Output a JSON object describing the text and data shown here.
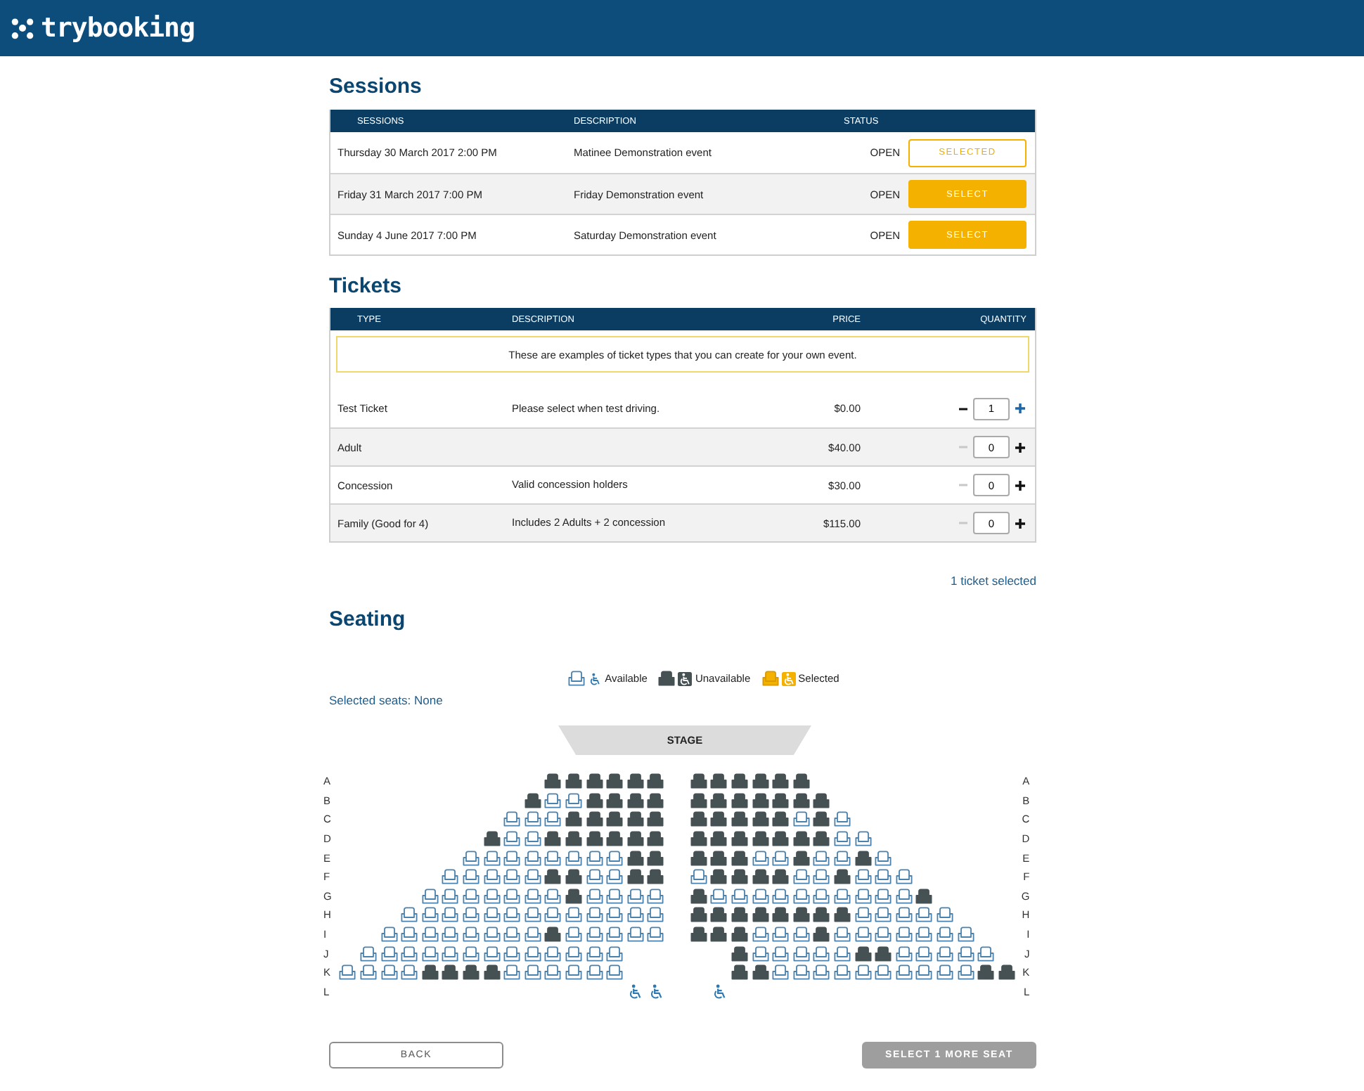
{
  "header": {
    "logo_text": "trybooking"
  },
  "sessions": {
    "title": "Sessions",
    "columns": [
      "SESSIONS",
      "DESCRIPTION",
      "STATUS"
    ],
    "rows": [
      {
        "session": "Thursday 30 March 2017 2:00 PM",
        "description": "Matinee Demonstration event",
        "status": "OPEN",
        "button": "SELECTED",
        "selected": true
      },
      {
        "session": "Friday 31 March 2017 7:00 PM",
        "description": "Friday Demonstration event",
        "status": "OPEN",
        "button": "SELECT",
        "selected": false
      },
      {
        "session": "Sunday 4 June 2017 7:00 PM",
        "description": "Saturday Demonstration event",
        "status": "OPEN",
        "button": "SELECT",
        "selected": false
      }
    ]
  },
  "tickets": {
    "title": "Tickets",
    "columns": [
      "TYPE",
      "DESCRIPTION",
      "PRICE",
      "QUANTITY"
    ],
    "note": "These are examples of ticket types that you can create for your own event.",
    "rows": [
      {
        "type": "Test Ticket",
        "description": "Please select when test driving.",
        "price": "$0.00",
        "quantity": "1",
        "decrease_disabled": false
      },
      {
        "type": "Adult",
        "price": "$40.00",
        "quantity": "0",
        "decrease_disabled": true
      },
      {
        "type": "Concession",
        "description": "Valid concession holders",
        "price": "$30.00",
        "quantity": "0",
        "decrease_disabled": true
      },
      {
        "type": "Family (Good for 4)",
        "description": "Includes 2 Adults + 2 concession",
        "price": "$115.00",
        "quantity": "0",
        "decrease_disabled": true
      }
    ],
    "summary": "1 ticket selected"
  },
  "seating": {
    "title": "Seating",
    "legend": [
      {
        "kind": "available",
        "label": "Available"
      },
      {
        "kind": "unavailable",
        "label": "Unavailable"
      },
      {
        "kind": "selected",
        "label": "Selected"
      }
    ],
    "selected_seats": "Selected seats: None",
    "stage": "STAGE",
    "rows": [
      {
        "label_left": "A",
        "label_right": "A",
        "left": [
          {
            "kind": "unavailable"
          },
          {
            "kind": "unavailable"
          },
          {
            "kind": "unavailable"
          },
          {
            "kind": "unavailable"
          },
          {
            "kind": "unavailable"
          },
          {
            "kind": "unavailable"
          }
        ],
        "right": [
          {
            "kind": "unavailable"
          },
          {
            "kind": "unavailable"
          },
          {
            "kind": "unavailable"
          },
          {
            "kind": "unavailable"
          },
          {
            "kind": "unavailable"
          },
          {
            "kind": "unavailable"
          }
        ]
      },
      {
        "label_left": "B",
        "label_right": "B",
        "left": [
          {
            "kind": "unavailable"
          },
          {
            "kind": "available"
          },
          {
            "kind": "available"
          },
          {
            "kind": "unavailable"
          },
          {
            "kind": "unavailable"
          },
          {
            "kind": "unavailable"
          },
          {
            "kind": "unavailable"
          }
        ],
        "right": [
          {
            "kind": "unavailable"
          },
          {
            "kind": "unavailable"
          },
          {
            "kind": "unavailable"
          },
          {
            "kind": "unavailable"
          },
          {
            "kind": "unavailable"
          },
          {
            "kind": "unavailable"
          },
          {
            "kind": "unavailable"
          }
        ]
      },
      {
        "label_left": "C",
        "label_right": "C",
        "left": [
          {
            "kind": "available"
          },
          {
            "kind": "available"
          },
          {
            "kind": "available"
          },
          {
            "kind": "unavailable"
          },
          {
            "kind": "unavailable"
          },
          {
            "kind": "unavailable"
          },
          {
            "kind": "unavailable"
          },
          {
            "kind": "unavailable"
          }
        ],
        "right": [
          {
            "kind": "unavailable"
          },
          {
            "kind": "unavailable"
          },
          {
            "kind": "unavailable"
          },
          {
            "kind": "unavailable"
          },
          {
            "kind": "unavailable"
          },
          {
            "kind": "available"
          },
          {
            "kind": "unavailable"
          },
          {
            "kind": "available"
          }
        ]
      },
      {
        "label_left": "D",
        "label_right": "D",
        "left": [
          {
            "kind": "unavailable"
          },
          {
            "kind": "available"
          },
          {
            "kind": "available"
          },
          {
            "kind": "unavailable"
          },
          {
            "kind": "unavailable"
          },
          {
            "kind": "unavailable"
          },
          {
            "kind": "unavailable"
          },
          {
            "kind": "unavailable"
          },
          {
            "kind": "unavailable"
          }
        ],
        "right": [
          {
            "kind": "unavailable"
          },
          {
            "kind": "unavailable"
          },
          {
            "kind": "unavailable"
          },
          {
            "kind": "unavailable"
          },
          {
            "kind": "unavailable"
          },
          {
            "kind": "unavailable"
          },
          {
            "kind": "unavailable"
          },
          {
            "kind": "available"
          },
          {
            "kind": "available"
          }
        ]
      },
      {
        "label_left": "E",
        "label_right": "E",
        "left": [
          {
            "kind": "available"
          },
          {
            "kind": "available"
          },
          {
            "kind": "available"
          },
          {
            "kind": "available"
          },
          {
            "kind": "available"
          },
          {
            "kind": "available"
          },
          {
            "kind": "available"
          },
          {
            "kind": "available"
          },
          {
            "kind": "unavailable"
          },
          {
            "kind": "unavailable"
          }
        ],
        "right": [
          {
            "kind": "unavailable"
          },
          {
            "kind": "unavailable"
          },
          {
            "kind": "unavailable"
          },
          {
            "kind": "available"
          },
          {
            "kind": "available"
          },
          {
            "kind": "unavailable"
          },
          {
            "kind": "available"
          },
          {
            "kind": "available"
          },
          {
            "kind": "unavailable"
          },
          {
            "kind": "available"
          }
        ]
      },
      {
        "label_left": "F",
        "label_right": "F",
        "left": [
          {
            "kind": "available"
          },
          {
            "kind": "available"
          },
          {
            "kind": "available"
          },
          {
            "kind": "available"
          },
          {
            "kind": "available"
          },
          {
            "kind": "unavailable"
          },
          {
            "kind": "unavailable"
          },
          {
            "kind": "available"
          },
          {
            "kind": "available"
          },
          {
            "kind": "unavailable"
          },
          {
            "kind": "unavailable"
          }
        ],
        "right": [
          {
            "kind": "available"
          },
          {
            "kind": "unavailable"
          },
          {
            "kind": "unavailable"
          },
          {
            "kind": "unavailable"
          },
          {
            "kind": "unavailable"
          },
          {
            "kind": "available"
          },
          {
            "kind": "available"
          },
          {
            "kind": "unavailable"
          },
          {
            "kind": "available"
          },
          {
            "kind": "available"
          },
          {
            "kind": "available"
          }
        ]
      },
      {
        "label_left": "G",
        "label_right": "G",
        "left": [
          {
            "kind": "available"
          },
          {
            "kind": "available"
          },
          {
            "kind": "available"
          },
          {
            "kind": "available"
          },
          {
            "kind": "available"
          },
          {
            "kind": "available"
          },
          {
            "kind": "available"
          },
          {
            "kind": "unavailable"
          },
          {
            "kind": "available"
          },
          {
            "kind": "available"
          },
          {
            "kind": "available"
          },
          {
            "kind": "available"
          }
        ],
        "right": [
          {
            "kind": "unavailable"
          },
          {
            "kind": "available"
          },
          {
            "kind": "available"
          },
          {
            "kind": "available"
          },
          {
            "kind": "available"
          },
          {
            "kind": "available"
          },
          {
            "kind": "available"
          },
          {
            "kind": "available"
          },
          {
            "kind": "available"
          },
          {
            "kind": "available"
          },
          {
            "kind": "available"
          },
          {
            "kind": "unavailable"
          }
        ]
      },
      {
        "label_left": "H",
        "label_right": "H",
        "left": [
          {
            "kind": "available"
          },
          {
            "kind": "available"
          },
          {
            "kind": "available"
          },
          {
            "kind": "available"
          },
          {
            "kind": "available"
          },
          {
            "kind": "available"
          },
          {
            "kind": "available"
          },
          {
            "kind": "available"
          },
          {
            "kind": "available"
          },
          {
            "kind": "available"
          },
          {
            "kind": "available"
          },
          {
            "kind": "available"
          },
          {
            "kind": "available"
          }
        ],
        "right": [
          {
            "kind": "unavailable"
          },
          {
            "kind": "unavailable"
          },
          {
            "kind": "unavailable"
          },
          {
            "kind": "unavailable"
          },
          {
            "kind": "unavailable"
          },
          {
            "kind": "unavailable"
          },
          {
            "kind": "unavailable"
          },
          {
            "kind": "unavailable"
          },
          {
            "kind": "available"
          },
          {
            "kind": "available"
          },
          {
            "kind": "available"
          },
          {
            "kind": "available"
          },
          {
            "kind": "available"
          }
        ]
      },
      {
        "label_left": "I",
        "label_right": "I",
        "left": [
          {
            "kind": "available"
          },
          {
            "kind": "available"
          },
          {
            "kind": "available"
          },
          {
            "kind": "available"
          },
          {
            "kind": "available"
          },
          {
            "kind": "available"
          },
          {
            "kind": "available"
          },
          {
            "kind": "available"
          },
          {
            "kind": "unavailable"
          },
          {
            "kind": "available"
          },
          {
            "kind": "available"
          },
          {
            "kind": "available"
          },
          {
            "kind": "available"
          },
          {
            "kind": "available"
          }
        ],
        "right": [
          {
            "kind": "unavailable"
          },
          {
            "kind": "unavailable"
          },
          {
            "kind": "unavailable"
          },
          {
            "kind": "available"
          },
          {
            "kind": "available"
          },
          {
            "kind": "available"
          },
          {
            "kind": "unavailable"
          },
          {
            "kind": "available"
          },
          {
            "kind": "available"
          },
          {
            "kind": "available"
          },
          {
            "kind": "available"
          },
          {
            "kind": "available"
          },
          {
            "kind": "available"
          },
          {
            "kind": "available"
          }
        ]
      },
      {
        "label_left": "J",
        "label_right": "J",
        "left": [
          {
            "kind": "available"
          },
          {
            "kind": "available"
          },
          {
            "kind": "available"
          },
          {
            "kind": "available"
          },
          {
            "kind": "available"
          },
          {
            "kind": "available"
          },
          {
            "kind": "available"
          },
          {
            "kind": "available"
          },
          {
            "kind": "available"
          },
          {
            "kind": "available"
          },
          {
            "kind": "available"
          },
          {
            "kind": "available"
          },
          {
            "kind": "available"
          },
          {
            "kind": "gap"
          },
          {
            "kind": "gap"
          }
        ],
        "right": [
          {
            "kind": "gap"
          },
          {
            "kind": "gap"
          },
          {
            "kind": "unavailable"
          },
          {
            "kind": "available"
          },
          {
            "kind": "available"
          },
          {
            "kind": "available"
          },
          {
            "kind": "available"
          },
          {
            "kind": "available"
          },
          {
            "kind": "unavailable"
          },
          {
            "kind": "unavailable"
          },
          {
            "kind": "available"
          },
          {
            "kind": "available"
          },
          {
            "kind": "available"
          },
          {
            "kind": "available"
          },
          {
            "kind": "available"
          }
        ]
      },
      {
        "label_left": "K",
        "label_right": "K",
        "left": [
          {
            "kind": "available"
          },
          {
            "kind": "available"
          },
          {
            "kind": "available"
          },
          {
            "kind": "available"
          },
          {
            "kind": "unavailable"
          },
          {
            "kind": "unavailable"
          },
          {
            "kind": "unavailable"
          },
          {
            "kind": "unavailable"
          },
          {
            "kind": "available"
          },
          {
            "kind": "available"
          },
          {
            "kind": "available"
          },
          {
            "kind": "available"
          },
          {
            "kind": "available"
          },
          {
            "kind": "available"
          },
          {
            "kind": "gap"
          },
          {
            "kind": "gap"
          }
        ],
        "right": [
          {
            "kind": "gap"
          },
          {
            "kind": "gap"
          },
          {
            "kind": "unavailable"
          },
          {
            "kind": "unavailable"
          },
          {
            "kind": "available"
          },
          {
            "kind": "available"
          },
          {
            "kind": "available"
          },
          {
            "kind": "available"
          },
          {
            "kind": "available"
          },
          {
            "kind": "available"
          },
          {
            "kind": "available"
          },
          {
            "kind": "available"
          },
          {
            "kind": "available"
          },
          {
            "kind": "available"
          },
          {
            "kind": "unavailable"
          },
          {
            "kind": "unavailable"
          }
        ]
      },
      {
        "label_left": "L",
        "label_right": "L",
        "left": [
          {
            "kind": "wheelchair"
          },
          {
            "kind": "wheelchair"
          }
        ],
        "right": [
          {
            "kind": "gap"
          },
          {
            "kind": "wheelchair"
          }
        ]
      }
    ]
  },
  "footer": {
    "back": "BACK",
    "next": {
      "label": "SELECT 1 MORE SEAT",
      "disabled": true
    }
  }
}
